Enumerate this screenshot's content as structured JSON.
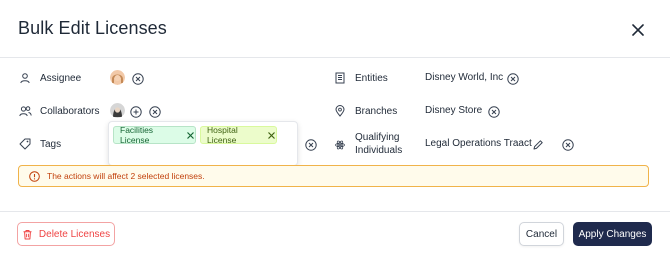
{
  "dialog": {
    "title": "Bulk Edit Licenses"
  },
  "fields": {
    "assignee": {
      "label": "Assignee"
    },
    "collaborators": {
      "label": "Collaborators"
    },
    "tags": {
      "label": "Tags",
      "chips": [
        {
          "label": "Facilities License"
        },
        {
          "label": "Hospital License"
        }
      ]
    },
    "entities": {
      "label": "Entities",
      "value": "Disney World, Inc"
    },
    "branches": {
      "label": "Branches",
      "value": "Disney Store"
    },
    "qualifying_individuals": {
      "label_line1": "Qualifying",
      "label_line2": "Individuals",
      "value": "Legal Operations Traact"
    }
  },
  "alert": {
    "text": "The actions will affect 2 selected licenses."
  },
  "footer": {
    "delete_label": "Delete Licenses",
    "cancel_label": "Cancel",
    "apply_label": "Apply Changes"
  },
  "colors": {
    "primary": "#1f2a4d",
    "danger": "#ef4444",
    "warning_border": "#f0b34a",
    "warning_text": "#c2410c"
  },
  "icons": {
    "close": "close-icon",
    "assignee": "user-icon",
    "collaborators": "users-icon",
    "tags": "tag-icon",
    "entities": "building-icon",
    "branches": "map-pin-icon",
    "qualifying": "atom-icon",
    "alert": "info-icon",
    "delete": "trash-icon",
    "edit": "pencil-icon"
  }
}
